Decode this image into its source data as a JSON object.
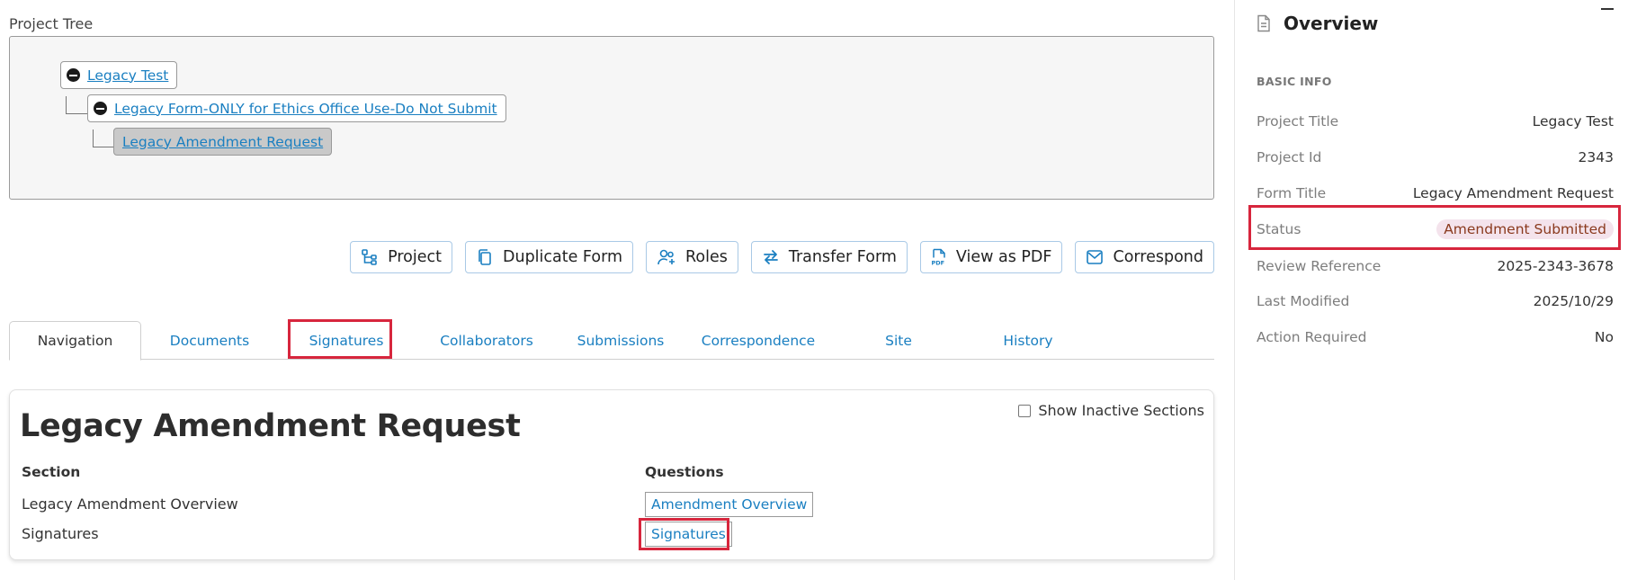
{
  "project_tree": {
    "label": "Project Tree",
    "nodes": [
      {
        "label": "Legacy Test"
      },
      {
        "label": "Legacy Form-ONLY for Ethics Office Use-Do Not Submit"
      },
      {
        "label": "Legacy Amendment Request"
      }
    ]
  },
  "toolbar": {
    "buttons": [
      {
        "label": "Project",
        "icon": "project-tree-icon"
      },
      {
        "label": "Duplicate Form",
        "icon": "duplicate-icon"
      },
      {
        "label": "Roles",
        "icon": "users-icon"
      },
      {
        "label": "Transfer Form",
        "icon": "transfer-icon"
      },
      {
        "label": "View as PDF",
        "icon": "pdf-icon"
      },
      {
        "label": "Correspond",
        "icon": "mail-icon"
      }
    ]
  },
  "tabs": [
    {
      "label": "Navigation"
    },
    {
      "label": "Documents"
    },
    {
      "label": "Signatures"
    },
    {
      "label": "Collaborators"
    },
    {
      "label": "Submissions"
    },
    {
      "label": "Correspondence"
    },
    {
      "label": "Site"
    },
    {
      "label": "History"
    }
  ],
  "form": {
    "title": "Legacy Amendment Request",
    "show_inactive_label": "Show Inactive Sections",
    "show_inactive_checked": false,
    "columns": {
      "section": "Section",
      "questions": "Questions"
    },
    "rows": [
      {
        "section": "Legacy Amendment Overview",
        "question": "Amendment Overview"
      },
      {
        "section": "Signatures",
        "question": "Signatures"
      }
    ]
  },
  "overview": {
    "title": "Overview",
    "section_label": "BASIC INFO",
    "fields": [
      {
        "key": "Project Title",
        "value": "Legacy Test"
      },
      {
        "key": "Project Id",
        "value": "2343"
      },
      {
        "key": "Form Title",
        "value": "Legacy Amendment Request"
      },
      {
        "key": "Status",
        "value": "Amendment Submitted"
      },
      {
        "key": "Review Reference",
        "value": "2025-2343-3678"
      },
      {
        "key": "Last Modified",
        "value": "2025/10/29"
      },
      {
        "key": "Action Required",
        "value": "No"
      }
    ]
  },
  "colors": {
    "link": "#1a7fc1",
    "highlight": "#d7263d",
    "status_badge_bg": "#f4e3ec",
    "status_badge_text": "#8a3a1e"
  }
}
